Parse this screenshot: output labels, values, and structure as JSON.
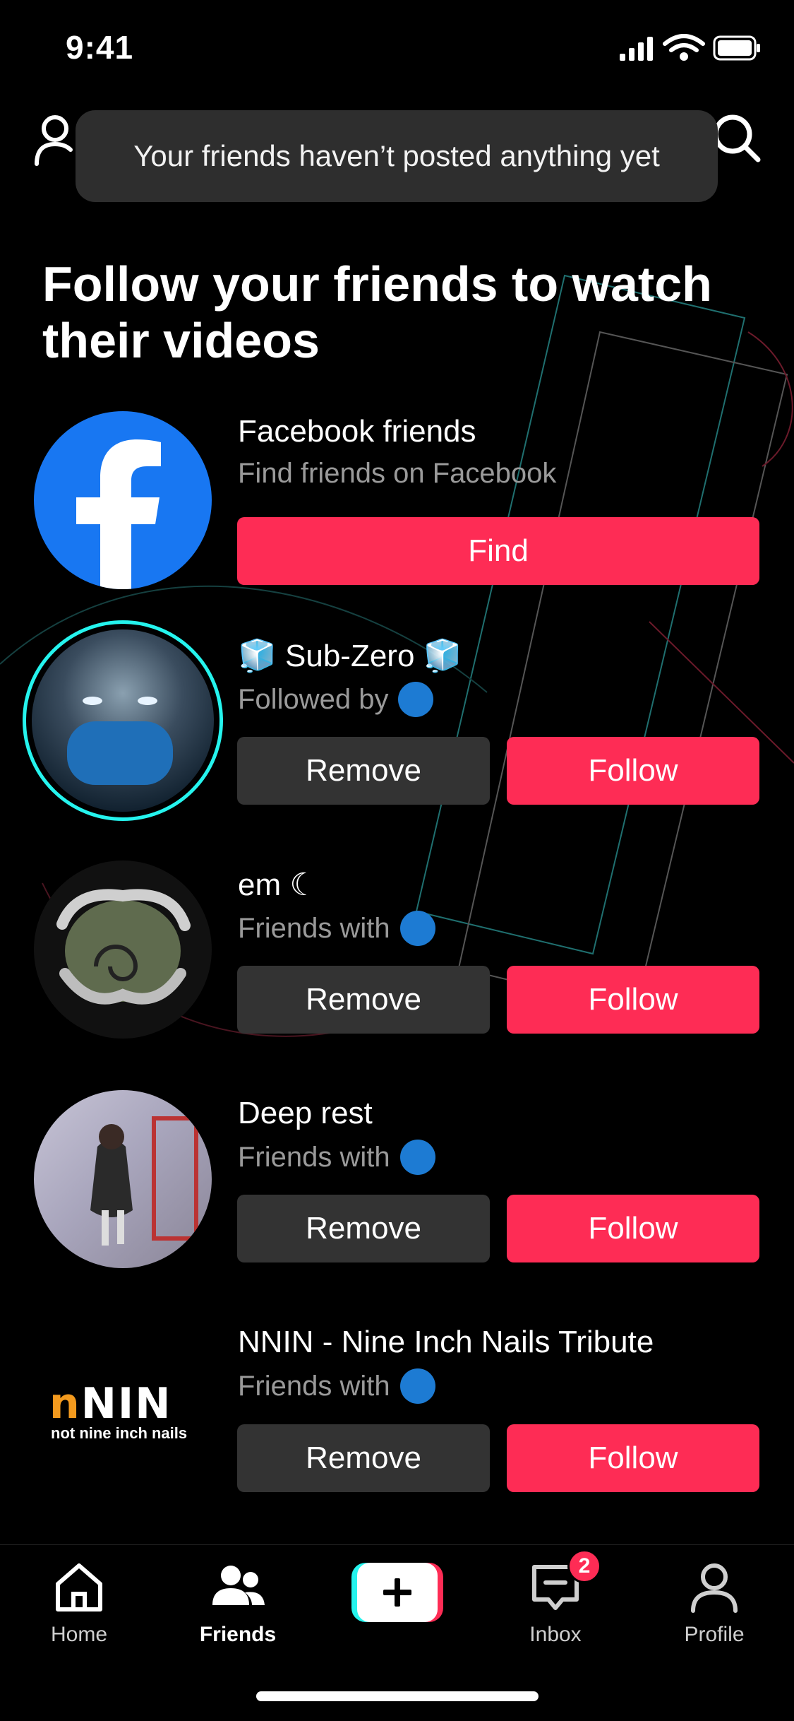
{
  "status_bar": {
    "time": "9:41"
  },
  "header": {
    "toast": "Your friends haven’t posted anything yet"
  },
  "heading": "Follow your friends to watch their videos",
  "facebook": {
    "title": "Facebook friends",
    "subtitle": "Find friends on Facebook",
    "button": "Find"
  },
  "suggestions": [
    {
      "name": "🧊 Sub-Zero 🧊",
      "relation": "Followed by",
      "remove": "Remove",
      "follow": "Follow"
    },
    {
      "name": "em ☾",
      "relation": "Friends with",
      "remove": "Remove",
      "follow": "Follow"
    },
    {
      "name": "Deep rest",
      "relation": "Friends with",
      "remove": "Remove",
      "follow": "Follow"
    },
    {
      "name": "NNIN - Nine Inch Nails Tribute",
      "relation": "Friends with",
      "remove": "Remove",
      "follow": "Follow"
    }
  ],
  "nnin_logo": {
    "mark": "nNIN",
    "tagline": "not nine inch nails"
  },
  "nav": {
    "home": "Home",
    "friends": "Friends",
    "inbox": "Inbox",
    "profile": "Profile",
    "inbox_badge": "2"
  },
  "colors": {
    "accent": "#fe2c55",
    "cyan": "#25f4ee",
    "button_gray": "#333333"
  }
}
